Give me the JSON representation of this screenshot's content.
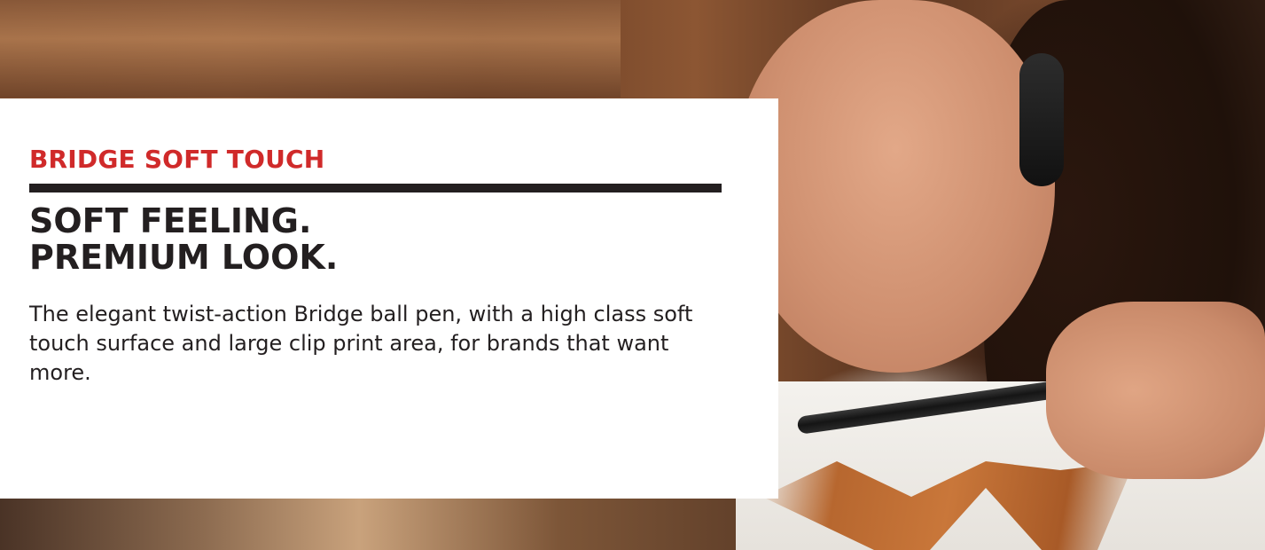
{
  "hero": {
    "image_description": "woman-with-headset-holding-pen"
  },
  "card": {
    "eyebrow": "BRIDGE SOFT TOUCH",
    "headline_line1": "SOFT FEELING.",
    "headline_line2": "PREMIUM LOOK.",
    "body": "The elegant twist-action Bridge ball pen, with a high class soft touch surface and large clip print area, for brands that want more."
  },
  "colors": {
    "accent": "#d02a2a",
    "text": "#231f20",
    "card_background": "#ffffff"
  }
}
